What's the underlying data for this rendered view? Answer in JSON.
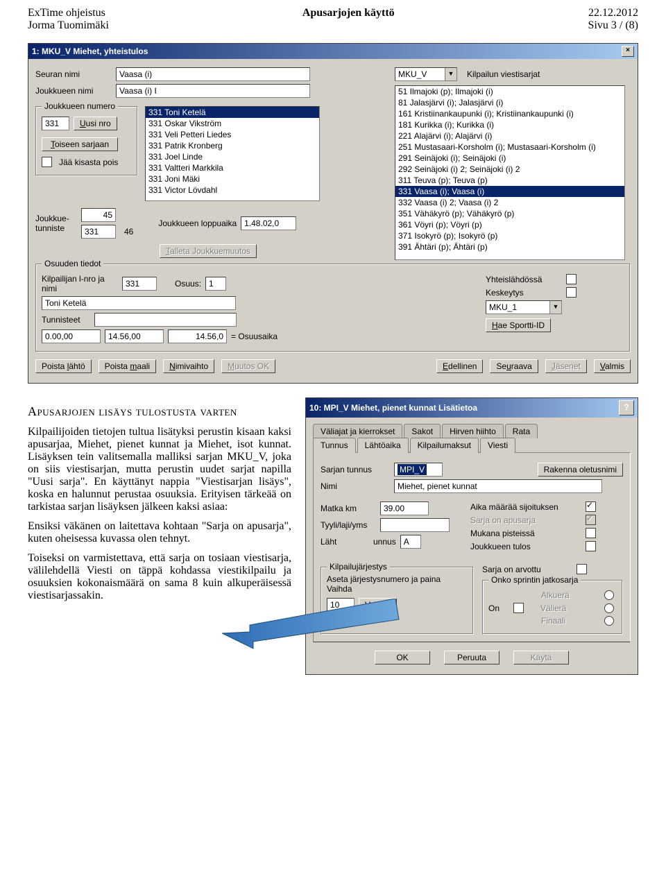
{
  "header": {
    "left": "ExTime ohjeistus",
    "center": "Apusarjojen käyttö",
    "right": "22.12.2012",
    "left2": "Jorma Tuomimäki",
    "right2": "Sivu 3 / (8)"
  },
  "win1": {
    "title": "1: MKU_V Miehet, yhteistulos",
    "labels": {
      "seura": "Seuran nimi",
      "joukkue": "Joukkueen nimi",
      "viesti": "Kilpailun viestisarjat",
      "jnro_grp": "Joukkueen numero",
      "uusi": "Uusi nro",
      "toiseen": "Toiseen sarjaan",
      "jaa": "Jää kisasta pois",
      "jtunniste": "Joukkue-\ntunniste",
      "loppu": "Joukkueen loppuaika",
      "talleta": "Talleta Joukkuemuutos",
      "osuus_grp": "Osuuden tiedot",
      "kilp": "Kilpailijan l-nro ja nimi",
      "osuus": "Osuus:",
      "yht": "Yhteislähdössä",
      "kesk": "Keskeytys",
      "tunn": "Tunnisteet",
      "hae": "Hae Sportti-ID",
      "osuusaika": "= Osuusaika",
      "plahto": "Poista lähtö",
      "pmaali": "Poista maali",
      "nimiv": "Nimivaihto",
      "muutos": "Muutos OK",
      "ed": "Edellinen",
      "seur": "Seuraava",
      "jas": "Jäsenet",
      "valmis": "Valmis"
    },
    "values": {
      "seura": "Vaasa (i)",
      "joukkue": "Vaasa (i) I",
      "series_code": "MKU_V",
      "jnro": "331",
      "tun_a": "45",
      "tun_b": "46",
      "tun_c": "331",
      "loppuaika": "1.48.02,0",
      "kilp_nro": "331",
      "osuus": "1",
      "nimi": "Toni Ketelä",
      "sarja_sel": "MKU_1",
      "t1": "0.00,00",
      "t2": "14.56,00",
      "t3": "14.56,0"
    },
    "members": [
      "331 Toni Ketelä",
      "331 Oskar Vikström",
      "331 Veli Petteri Liedes",
      "331 Patrik Kronberg",
      "331 Joel Linde",
      "331 Valtteri Markkila",
      "331 Joni Mäki",
      "331 Victor Lövdahl"
    ],
    "series": [
      "51 Ilmajoki (p); Ilmajoki (i)",
      "81 Jalasjärvi (i); Jalasjärvi (i)",
      "161 Kristiinankaupunki (i); Kristiinankaupunki (i)",
      "181 Kurikka (i); Kurikka (i)",
      "221 Alajärvi (i); Alajärvi (i)",
      "251 Mustasaari-Korsholm (i); Mustasaari-Korsholm (i)",
      "291 Seinäjoki (i); Seinäjoki (i)",
      "292 Seinäjoki (i) 2; Seinäjoki (i) 2",
      "311 Teuva (p); Teuva (p)",
      "331 Vaasa (i); Vaasa (i)",
      "332 Vaasa (i) 2; Vaasa (i) 2",
      "351 Vähäkyrö (p); Vähäkyrö (p)",
      "361 Vöyri (p); Vöyri (p)",
      "371 Isokyrö (p); Isokyrö (p)",
      "391 Ähtäri (p); Ähtäri (p)"
    ],
    "series_selected_index": 9
  },
  "article": {
    "heading": "Apusarjojen   lisäys   tulostusta varten",
    "p1": "Kilpailijoiden tietojen tultua lisätyksi perustin kisaan kaksi apusarjaa, Miehet, pienet kunnat ja Miehet, isot kunnat. Lisäyksen tein valitsemalla malliksi sarjan MKU_V, joka on siis viestisarjan, mutta perustin uudet sarjat napilla \"Uusi sarja\". En käyttänyt nappia \"Viestisarjan lisäys\", koska en halunnut perustaa osuuksia. Erityisen tärkeää on tarkistaa sarjan lisäyksen jälkeen kaksi asiaa:",
    "p2": "Ensiksi väkänen on laitettava kohtaan \"Sarja on apusarja\", kuten oheisessa kuvassa olen tehnyt.",
    "p3": "Toiseksi on varmistettava, että sarja on tosiaan viestisarja, välilehdellä Viesti on täppä kohdassa viestikilpailu ja osuuksien kokonaismäärä on sama 8 kuin alkuperäisessä viestisarjassakin."
  },
  "win2": {
    "title": "10: MPI_V Miehet, pienet kunnat Lisätietoa",
    "tabs_back": [
      "Väliajat ja kierrokset",
      "Sakot",
      "Hirven hiihto",
      "Rata"
    ],
    "tabs_front": [
      "Tunnus",
      "Lähtöaika",
      "Kilpailumaksut",
      "Viesti"
    ],
    "active_tab": "Tunnus",
    "labels": {
      "stun": "Sarjan tunnus",
      "rak": "Rakenna oletusnimi",
      "nimi": "Nimi",
      "matka": "Matka km",
      "tyyli": "Tyyli/laji/yms",
      "lahti": "Läht",
      "tunnus_tail": "unnus",
      "aika": "Aika määrää sijoituksen",
      "apu": "Sarja on apusarja",
      "muk": "Mukana pisteissä",
      "jtul": "Joukkueen tulos",
      "kj_grp": "Kilpailujärjestys",
      "aseta": "Aseta järjestysnumero ja paina Vaihda",
      "vaihda": "Vaihda",
      "arv": "Sarja on arvottu",
      "onko_grp": "Onko sprintin jatkosarja",
      "alku": "Alkuerä",
      "on": "On",
      "vali": "Välierä",
      "fin": "Finaali",
      "ok": "OK",
      "peruuta": "Peruuta",
      "kayta": "Käytä"
    },
    "values": {
      "stun": "MPI_V",
      "nimi": "Miehet, pienet kunnat",
      "matka": "39.00",
      "tyyli": "",
      "ltun": "A",
      "jnro": "10"
    }
  }
}
